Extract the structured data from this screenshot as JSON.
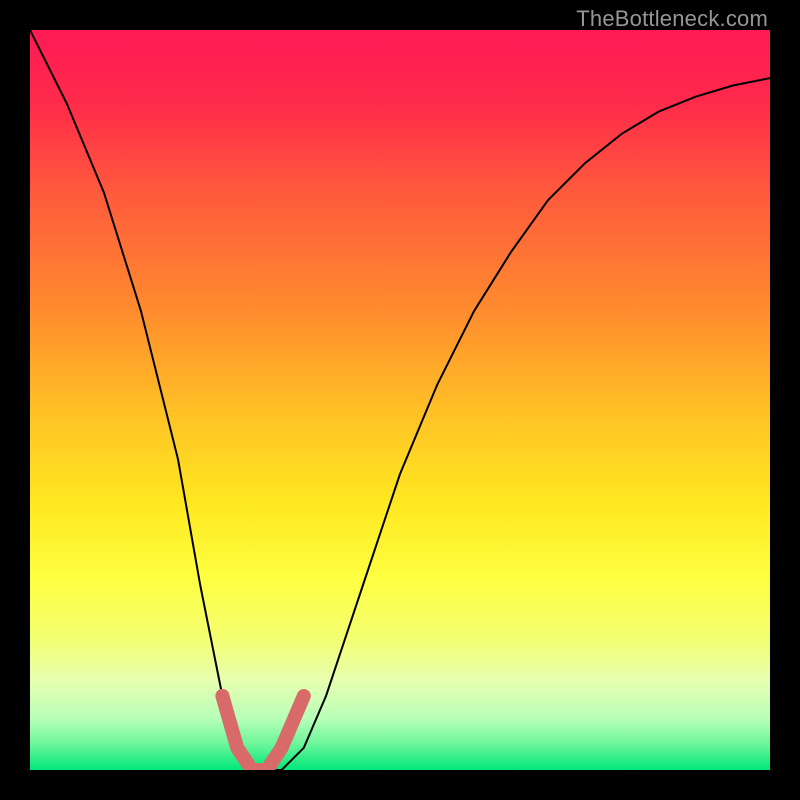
{
  "watermark": "TheBottleneck.com",
  "chart_data": {
    "type": "line",
    "title": "",
    "xlabel": "",
    "ylabel": "",
    "xlim": [
      0,
      100
    ],
    "ylim": [
      0,
      100
    ],
    "grid": false,
    "series": [
      {
        "name": "bottleneck-curve",
        "x": [
          0,
          5,
          10,
          15,
          20,
          23,
          26,
          28,
          30,
          32,
          34,
          37,
          40,
          45,
          50,
          55,
          60,
          65,
          70,
          75,
          80,
          85,
          90,
          95,
          100
        ],
        "values": [
          100,
          90,
          78,
          62,
          42,
          25,
          10,
          3,
          0,
          0,
          0,
          3,
          10,
          25,
          40,
          52,
          62,
          70,
          77,
          82,
          86,
          89,
          91,
          92.5,
          93.5
        ]
      }
    ],
    "highlight_segment": {
      "name": "optimal-range",
      "x": [
        26,
        28,
        30,
        32,
        34,
        37
      ],
      "values": [
        10,
        3,
        0,
        0,
        3,
        10
      ],
      "color": "#d96a6a"
    },
    "highlight_point": {
      "x": 26,
      "y": 10,
      "color": "#d96a6a"
    },
    "background_gradient": {
      "top_color": "#ff1a55",
      "mid_colors": [
        "#ff5a3c",
        "#ffa628",
        "#ffe820",
        "#f6ff50",
        "#e8ffb0"
      ],
      "bottom_color": "#00e87a"
    }
  }
}
